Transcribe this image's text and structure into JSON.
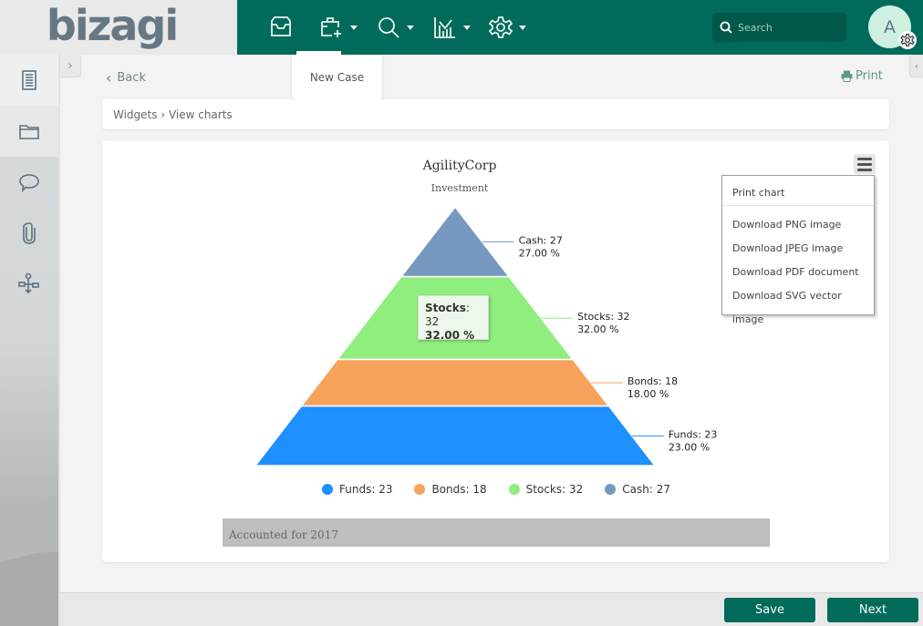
{
  "header": {
    "logo_text": "bizagi",
    "nav": [
      {
        "icon": "inbox-icon",
        "has_menu": false
      },
      {
        "icon": "new-case-icon",
        "has_menu": true,
        "active": true
      },
      {
        "icon": "search-icon",
        "has_menu": true
      },
      {
        "icon": "analytics-icon",
        "has_menu": true
      },
      {
        "icon": "gear-icon",
        "has_menu": true
      }
    ],
    "search_placeholder": "Search",
    "avatar_initial": "A"
  },
  "new_case_popup": {
    "label": "New Case"
  },
  "sidebar": {
    "items": [
      {
        "icon": "form-icon"
      },
      {
        "icon": "folder-icon"
      },
      {
        "icon": "comment-icon"
      },
      {
        "icon": "attachment-icon"
      },
      {
        "icon": "process-flow-icon"
      }
    ]
  },
  "toolbar": {
    "back_label": "Back",
    "print_label": "Print"
  },
  "breadcrumb": {
    "text": "Widgets › View charts"
  },
  "export_menu": {
    "items": [
      "Print chart",
      "Download PNG image",
      "Download JPEG image",
      "Download PDF document",
      "Download SVG vector image"
    ]
  },
  "tooltip": {
    "name": "Stocks",
    "value": ": 32",
    "percent": "32.00 %"
  },
  "caption": "Accounted for 2017",
  "footer": {
    "save_label": "Save",
    "next_label": "Next"
  },
  "chart_data": {
    "type": "pyramid",
    "title": "AgilityCorp",
    "subtitle": "Investment",
    "series": [
      {
        "name": "Cash",
        "value": 27,
        "percent": "27.00 %",
        "color": "#7798bf"
      },
      {
        "name": "Stocks",
        "value": 32,
        "percent": "32.00 %",
        "color": "#90ee7e"
      },
      {
        "name": "Bonds",
        "value": 18,
        "percent": "18.00 %",
        "color": "#f7a35c"
      },
      {
        "name": "Funds",
        "value": 23,
        "percent": "23.00 %",
        "color": "#2b908f"
      }
    ],
    "legend": [
      {
        "label": "Funds: 23",
        "color": "#1e90ff"
      },
      {
        "label": "Bonds: 18",
        "color": "#f7a35c"
      },
      {
        "label": "Stocks: 32",
        "color": "#90ee7e"
      },
      {
        "label": "Cash: 27",
        "color": "#7798bf"
      }
    ],
    "legend_position": "bottom",
    "order_top_to_bottom": [
      "Cash",
      "Stocks",
      "Bonds",
      "Funds"
    ]
  }
}
